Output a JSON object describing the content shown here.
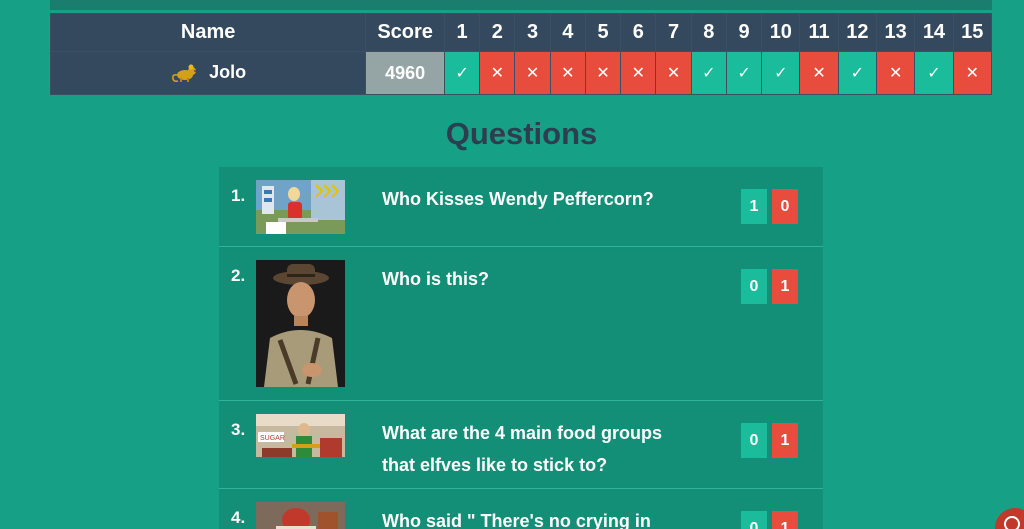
{
  "scoreboard": {
    "headers": {
      "name": "Name",
      "score": "Score",
      "questions": [
        "1",
        "2",
        "3",
        "4",
        "5",
        "6",
        "7",
        "8",
        "9",
        "10",
        "11",
        "12",
        "13",
        "14",
        "15"
      ]
    },
    "player": {
      "name": "Jolo",
      "avatar_icon": "mouse-icon",
      "score": "4960",
      "results": [
        "right",
        "wrong",
        "wrong",
        "wrong",
        "wrong",
        "wrong",
        "wrong",
        "right",
        "right",
        "right",
        "wrong",
        "right",
        "wrong",
        "right",
        "wrong"
      ]
    }
  },
  "questions": {
    "heading": "Questions",
    "items": [
      {
        "number": "1.",
        "text": "Who Kisses Wendy Peffercorn?",
        "right_count": "1",
        "wrong_count": "0"
      },
      {
        "number": "2.",
        "text": "Who is this?",
        "right_count": "0",
        "wrong_count": "1"
      },
      {
        "number": "3.",
        "text": "What are the 4 main food groups that elfves like to stick to?",
        "right_count": "0",
        "wrong_count": "1"
      },
      {
        "number": "4.",
        "text": "Who said \" There's no crying in",
        "right_count": "0",
        "wrong_count": "1"
      }
    ]
  },
  "colors": {
    "background": "#16a085",
    "header": "#34495e",
    "right": "#1abc9c",
    "wrong": "#e74c3c",
    "score_cell": "#95a5a6",
    "question_row": "#148f77"
  }
}
